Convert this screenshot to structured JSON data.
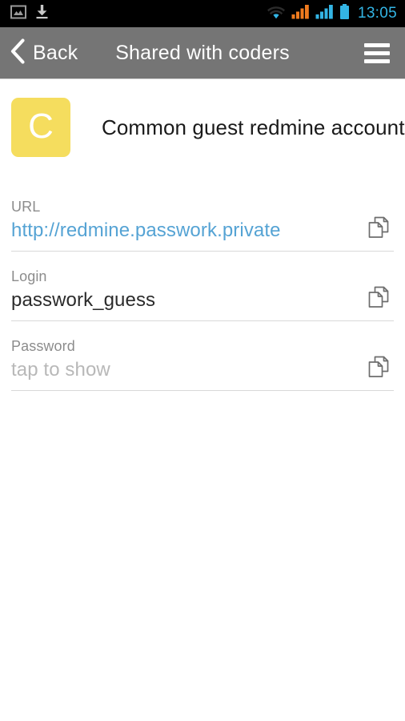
{
  "statusbar": {
    "icons_left": [
      {
        "name": "gallery-image-icon"
      },
      {
        "name": "download-icon"
      }
    ],
    "icons_right": [
      {
        "name": "wifi-icon"
      },
      {
        "name": "signal-bars-orange-icon"
      },
      {
        "name": "signal-bars-blue-icon"
      },
      {
        "name": "battery-icon"
      }
    ],
    "clock": "13:05",
    "clock_color": "#33b5e5",
    "background": "#000000"
  },
  "header": {
    "back_label": "Back",
    "title": "Shared with coders",
    "menu_icon": "hamburger-menu-icon",
    "background": "#757575",
    "text_color": "#ffffff"
  },
  "account": {
    "avatar_letter": "C",
    "avatar_color": "#f5dd5e",
    "name": "Common guest redmine account"
  },
  "fields": [
    {
      "label": "URL",
      "value": "http://redmine.passwork.private",
      "value_style": "link",
      "value_color": "#55a3d4",
      "copy_icon": "copy-icon"
    },
    {
      "label": "Login",
      "value": "passwork_guess",
      "value_style": "text",
      "value_color": "#2b2b2b",
      "copy_icon": "copy-icon"
    },
    {
      "label": "Password",
      "value": "tap to show",
      "value_style": "placeholder",
      "value_color": "#b8b8b8",
      "copy_icon": "copy-icon"
    }
  ]
}
